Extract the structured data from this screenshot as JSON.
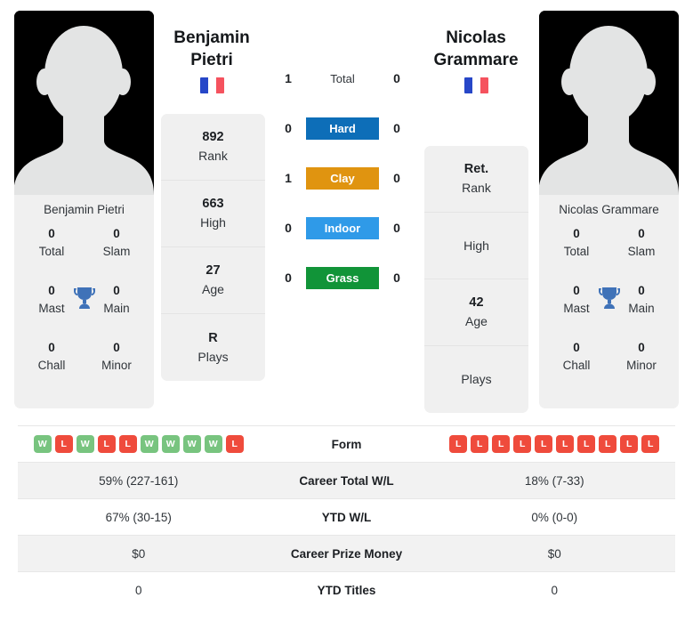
{
  "players": {
    "left": {
      "name": "Benjamin Pietri",
      "name_line1": "Benjamin",
      "name_line2": "Pietri",
      "flag": "france-flag",
      "avatar": "player-avatar-placeholder",
      "titles": [
        {
          "value": "0",
          "label": "Total"
        },
        {
          "value": "0",
          "label": "Slam"
        },
        {
          "value": "0",
          "label": "Mast"
        },
        {
          "value": "0",
          "label": "Main"
        },
        {
          "value": "0",
          "label": "Chall"
        },
        {
          "value": "0",
          "label": "Minor"
        }
      ],
      "info": [
        {
          "value": "892",
          "label": "Rank"
        },
        {
          "value": "663",
          "label": "High"
        },
        {
          "value": "27",
          "label": "Age"
        },
        {
          "value": "R",
          "label": "Plays"
        }
      ],
      "form": [
        "W",
        "L",
        "W",
        "L",
        "L",
        "W",
        "W",
        "W",
        "W",
        "L"
      ],
      "career_total_wl": "59% (227-161)",
      "ytd_wl": "67% (30-15)",
      "career_prize_money": "$0",
      "ytd_titles": "0"
    },
    "right": {
      "name": "Nicolas Grammare",
      "name_line1": "Nicolas",
      "name_line2": "Grammare",
      "flag": "france-flag",
      "avatar": "player-avatar-placeholder",
      "titles": [
        {
          "value": "0",
          "label": "Total"
        },
        {
          "value": "0",
          "label": "Slam"
        },
        {
          "value": "0",
          "label": "Mast"
        },
        {
          "value": "0",
          "label": "Main"
        },
        {
          "value": "0",
          "label": "Chall"
        },
        {
          "value": "0",
          "label": "Minor"
        }
      ],
      "info": [
        {
          "value": "Ret.",
          "label": "Rank"
        },
        {
          "value": "",
          "label": "High"
        },
        {
          "value": "42",
          "label": "Age"
        },
        {
          "value": "",
          "label": "Plays"
        }
      ],
      "form": [
        "L",
        "L",
        "L",
        "L",
        "L",
        "L",
        "L",
        "L",
        "L",
        "L"
      ],
      "career_total_wl": "18% (7-33)",
      "ytd_wl": "0% (0-0)",
      "career_prize_money": "$0",
      "ytd_titles": "0"
    }
  },
  "surfaces": [
    {
      "label": "Total",
      "left": "1",
      "right": "0",
      "color": "",
      "plain": true
    },
    {
      "label": "Hard",
      "left": "0",
      "right": "0",
      "color": "#0d6eb8"
    },
    {
      "label": "Clay",
      "left": "1",
      "right": "0",
      "color": "#e09410"
    },
    {
      "label": "Indoor",
      "left": "0",
      "right": "0",
      "color": "#2f9ae8"
    },
    {
      "label": "Grass",
      "left": "0",
      "right": "0",
      "color": "#119438"
    }
  ],
  "stats_rows": [
    {
      "label": "Form"
    },
    {
      "label": "Career Total W/L",
      "left": "59% (227-161)",
      "right": "18% (7-33)"
    },
    {
      "label": "YTD W/L",
      "left": "67% (30-15)",
      "right": "0% (0-0)"
    },
    {
      "label": "Career Prize Money",
      "left": "$0",
      "right": "$0"
    },
    {
      "label": "YTD Titles",
      "left": "0",
      "right": "0"
    }
  ],
  "colors": {
    "hard": "#0d6eb8",
    "clay": "#e09410",
    "indoor": "#2f9ae8",
    "grass": "#119438",
    "win": "#78c47f",
    "loss": "#ef4b3c",
    "trophy": "#3f72b8"
  }
}
